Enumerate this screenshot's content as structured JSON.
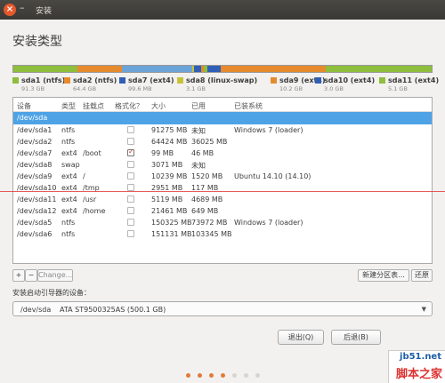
{
  "window": {
    "title": "安装",
    "close_glyph": "×",
    "min_glyph": "–"
  },
  "heading": "安装类型",
  "partition_bar": [
    {
      "color": "#8fbd3c",
      "share": 91.3
    },
    {
      "color": "#e68a2e",
      "share": 64.4
    },
    {
      "color": "#6da4d8",
      "share": 99.6
    },
    {
      "color": "#c7c23a",
      "share": 3.1
    },
    {
      "color": "#2f5fb7",
      "share": 10.2
    },
    {
      "color": "#e68a2e",
      "share": 3.0
    },
    {
      "color": "#8fbd3c",
      "share": 5.1
    },
    {
      "color": "#2f5fb7",
      "share": 20.0
    },
    {
      "color": "#e68a2e",
      "share": 150.0
    },
    {
      "color": "#8fbd3c",
      "share": 151.0
    }
  ],
  "legend": [
    {
      "name": "sda1 (ntfs)",
      "size": "91.3 GB",
      "color": "#8fbd3c"
    },
    {
      "name": "sda2 (ntfs)",
      "size": "64.4 GB",
      "color": "#e68a2e"
    },
    {
      "name": "sda7 (ext4)",
      "size": "99.6 MB",
      "color": "#2f5fb7"
    },
    {
      "name": "sda8 (linux-swap)",
      "size": "3.1 GB",
      "color": "#c7c23a"
    },
    {
      "name": "sda9 (ext4)",
      "size": "10.2 GB",
      "color": "#e68a2e"
    },
    {
      "name": "sda10 (ext4)",
      "size": "3.0 GB",
      "color": "#2f5fb7"
    },
    {
      "name": "sda11 (ext4)",
      "size": "5.1 GB",
      "color": "#8fbd3c"
    }
  ],
  "table": {
    "headers": [
      "设备",
      "类型",
      "挂载点",
      "格式化？",
      "大小",
      "已用",
      "已装系统"
    ],
    "rows": [
      {
        "device": "/dev/sda",
        "type": "",
        "mount": "",
        "format": null,
        "size": "",
        "used": "",
        "system": "",
        "selected": true
      },
      {
        "device": "/dev/sda1",
        "type": "ntfs",
        "mount": "",
        "format": false,
        "size": "91275 MB",
        "used": "未知",
        "system": "Windows 7 (loader)"
      },
      {
        "device": "/dev/sda2",
        "type": "ntfs",
        "mount": "",
        "format": false,
        "size": "64424 MB",
        "used": "36025 MB",
        "system": ""
      },
      {
        "device": "/dev/sda7",
        "type": "ext4",
        "mount": "/boot",
        "format": true,
        "size": "99 MB",
        "used": "46 MB",
        "system": ""
      },
      {
        "device": "/dev/sda8",
        "type": "swap",
        "mount": "",
        "format": false,
        "size": "3071 MB",
        "used": "未知",
        "system": ""
      },
      {
        "device": "/dev/sda9",
        "type": "ext4",
        "mount": "/",
        "format": false,
        "size": "10239 MB",
        "used": "1520 MB",
        "system": "Ubuntu 14.10 (14.10)"
      },
      {
        "device": "/dev/sda10",
        "type": "ext4",
        "mount": "/tmp",
        "format": false,
        "size": "2951 MB",
        "used": "117 MB",
        "system": ""
      },
      {
        "device": "/dev/sda11",
        "type": "ext4",
        "mount": "/usr",
        "format": false,
        "size": "5119 MB",
        "used": "4689 MB",
        "system": ""
      },
      {
        "device": "/dev/sda12",
        "type": "ext4",
        "mount": "/home",
        "format": false,
        "size": "21461 MB",
        "used": "649 MB",
        "system": ""
      },
      {
        "device": "/dev/sda5",
        "type": "ntfs",
        "mount": "",
        "format": false,
        "size": "150325 MB",
        "used": "73972 MB",
        "system": "Windows 7 (loader)"
      },
      {
        "device": "/dev/sda6",
        "type": "ntfs",
        "mount": "",
        "format": false,
        "size": "151131 MB",
        "used": "103345 MB",
        "system": ""
      }
    ]
  },
  "toolbar": {
    "add": "+",
    "remove": "−",
    "change": "Change...",
    "new_table": "新建分区表...",
    "revert": "还原"
  },
  "bootloader": {
    "label": "安装启动引导器的设备：",
    "device": "/dev/sda",
    "model": "ATA ST9500325AS (500.1 GB)",
    "caret": "▼"
  },
  "buttons": {
    "quit": "退出(Q)",
    "back": "后退(B)"
  },
  "progress_dots": {
    "count": 7,
    "active": 3
  },
  "watermark": {
    "top": "jb51.net",
    "bottom": "脚本之家"
  }
}
